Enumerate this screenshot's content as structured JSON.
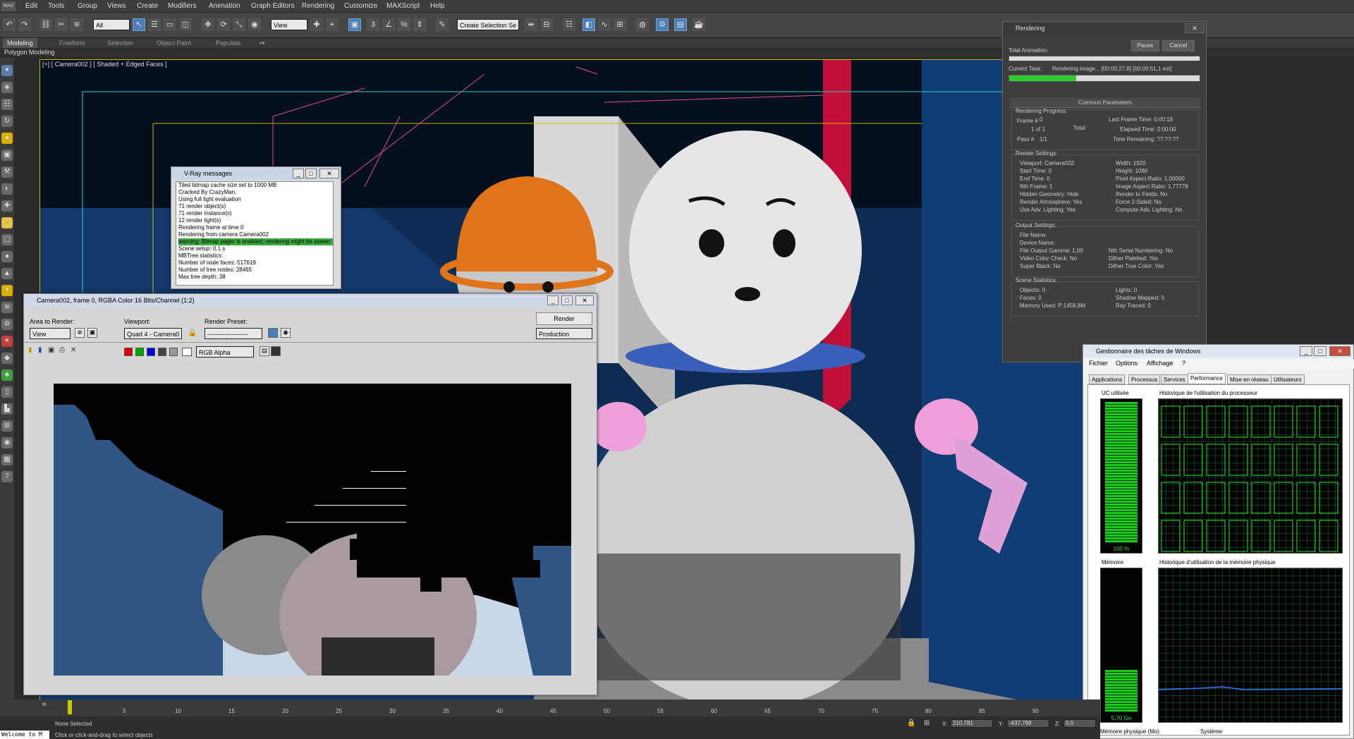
{
  "menubar": {
    "items": [
      "Edit",
      "Tools",
      "Group",
      "Views",
      "Create",
      "Modifiers",
      "Animation",
      "Graph Editors",
      "Rendering",
      "Customize",
      "MAXScript",
      "Help"
    ]
  },
  "toolbar": {
    "filter": "All",
    "view": "View",
    "selection_set": "Create Selection Se"
  },
  "ribbon": {
    "tabs": [
      "Modeling",
      "Freeform",
      "Selection",
      "Object Paint",
      "Populate"
    ],
    "panel": "Polygon Modeling"
  },
  "viewport": {
    "label": "[+] [ Camera002 ] [ Shaded + Edged Faces ]"
  },
  "vray": {
    "title": "V-Ray messages",
    "lines": [
      "Tiled bitmap cache size set to 1000 MB",
      "Cracked By CrazyMan.",
      "Using full light evaluation",
      "71 render object(s)",
      "71 render instance(s)",
      "12 render light(s)",
      "Rendering frame at time 0",
      "Rendering from camera Camera002",
      "warning: Bitmap pager is enabled; rendering might be slower",
      "Scene setup: 0.1 s",
      "MBTree statistics:",
      "Number of node faces: 517619",
      "Number of tree nodes: 28465",
      "Max tree depth: 38"
    ]
  },
  "framebuffer": {
    "title": "Camera002, frame 0, RGBA Color 16 Bits/Channel (1:2)",
    "area_label": "Area to Render:",
    "area_value": "View",
    "viewport_label": "Viewport:",
    "viewport_value": "Quad 4 - Camera0",
    "preset_label": "Render Preset:",
    "preset_value": "-------------------",
    "render_button": "Render",
    "production": "Production",
    "channel": "RGB Alpha"
  },
  "rendering": {
    "title": "Rendering",
    "pause": "Pause",
    "cancel": "Cancel",
    "total_animation": "Total Animation:",
    "current_task_label": "Current Task:",
    "current_task": "Rendering image... [00:00:27,8] [00:00:51,1 est]",
    "progress": 0.35,
    "common_params": "Common Parameters",
    "progress_group": "Rendering Progress:",
    "frame_label": "Frame #",
    "frame": "0",
    "of": "1 of 1",
    "total": "Total",
    "pass_label": "Pass #",
    "pass": "1/1",
    "last_frame_time": "Last Frame Time:  0:00:18",
    "elapsed_time": "Elapsed Time:  0:00:00",
    "time_remaining": "Time Remaining:  ??:??:??",
    "render_settings": "Render Settings:",
    "settings_left": [
      "Viewport: Camera002",
      "Start Time: 0",
      "End Time: 0",
      "Nth Frame: 1",
      "Hidden Geometry: Hide",
      "Render Atmosphere: Yes",
      "Use Adv. Lighting: Yes"
    ],
    "settings_right": [
      "Width: 1920",
      "Height: 1080",
      "Pixel Aspect Ratio: 1,00000",
      "Image Aspect Ratio: 1,77778",
      "Render to Fields: No",
      "Force 2-Sided: No",
      "Compute Adv. Lighting: No"
    ],
    "output_settings": "Output Settings:",
    "output_left": [
      "File Name:",
      "Device Name:",
      "File Output Gamma: 1,00",
      "Video Color Check: No",
      "Super Black: No"
    ],
    "output_right": [
      "Nth Serial Numbering: No",
      "Dither Paletted: Yes",
      "Dither True Color: Yes"
    ],
    "scene_statistics": "Scene Statistics:",
    "stats_left": [
      "Objects: 0",
      "Faces: 0",
      "Memory Used: P:1458,8M"
    ],
    "stats_right": [
      "Lights: 0",
      "Shadow Mapped: 0",
      "Ray Traced: 0"
    ]
  },
  "taskmgr": {
    "title": "Gestionnaire des tâches de Windows",
    "menu": [
      "Fichier",
      "Options",
      "Affichage",
      "?"
    ],
    "tabs": [
      "Applications",
      "Processus",
      "Services",
      "Performance",
      "Mise en réseau",
      "Utilisateurs"
    ],
    "cpu_label": "UC utilisée",
    "cpu_value": "100 %",
    "cpu_usage": 1.0,
    "cpu_history": "Historique de l'utilisation du processeur",
    "mem_label": "Mémoire",
    "mem_value": "5,70 Go",
    "mem_usage": 0.3,
    "mem_history": "Historique d'utilisation de la mémoire physique",
    "phys_mem": "Mémoire physique (Mo)",
    "system": "Système"
  },
  "timeline": {
    "ticks": [
      "5",
      "10",
      "15",
      "20",
      "25",
      "30",
      "35",
      "40",
      "45",
      "50",
      "55",
      "60",
      "65",
      "70",
      "75",
      "80",
      "85",
      "90"
    ]
  },
  "status": {
    "selection": "None Selected",
    "prompt": "Click or click-and-drag to select objects",
    "maxscript": "Welcome to M",
    "x_label": "X:",
    "x_value": "210,781",
    "y_label": "Y:",
    "y_value": "-437,798",
    "z_label": "Z:",
    "z_value": "0,0"
  }
}
